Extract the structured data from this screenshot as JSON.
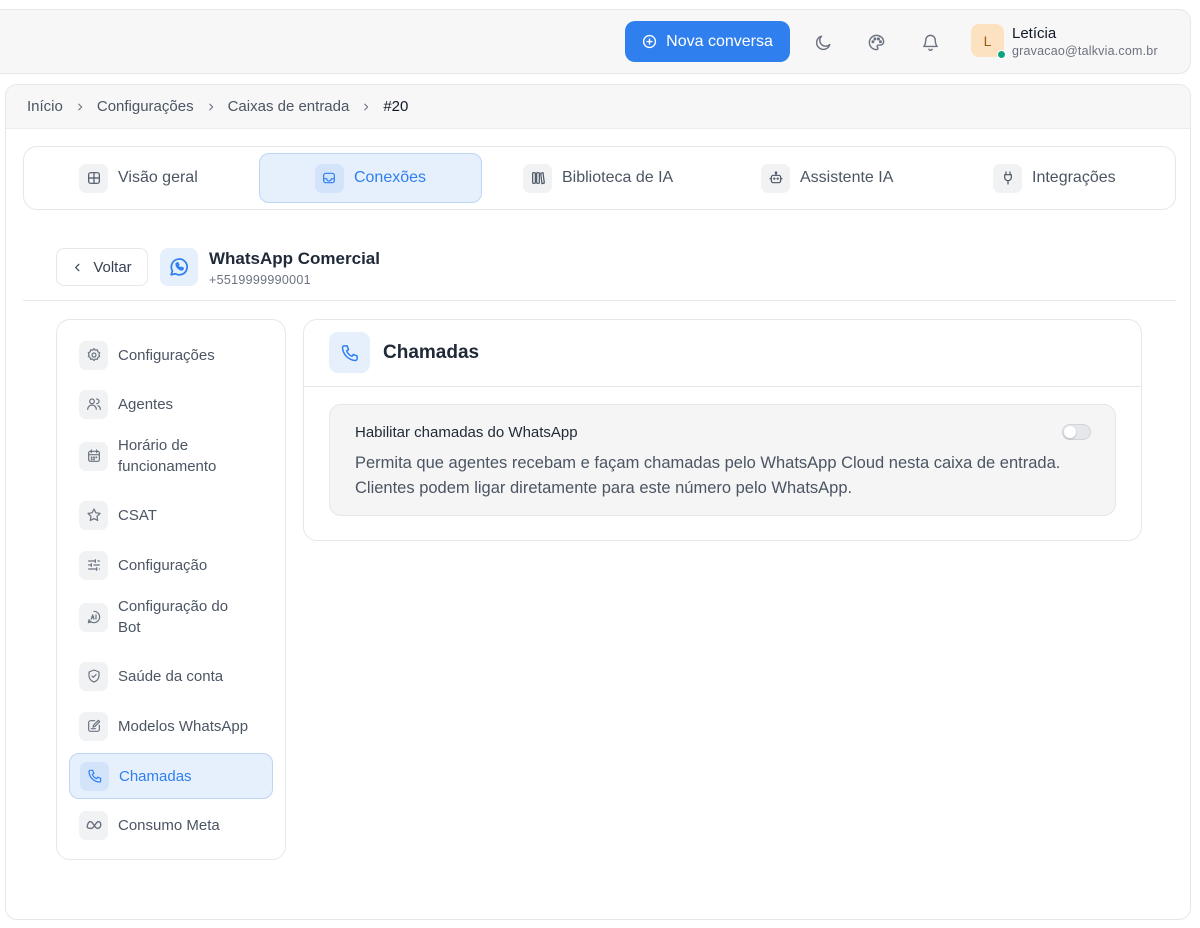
{
  "header": {
    "new_conversation_label": "Nova conversa",
    "user": {
      "initial": "L",
      "name": "Letícia",
      "email": "gravacao@talkvia.com.br"
    }
  },
  "breadcrumb": [
    "Início",
    "Configurações",
    "Caixas de entrada",
    "#20"
  ],
  "tabs": [
    {
      "label": "Visão geral",
      "icon": "grid-icon"
    },
    {
      "label": "Conexões",
      "icon": "inbox-icon",
      "active": true
    },
    {
      "label": "Biblioteca de IA",
      "icon": "library-icon"
    },
    {
      "label": "Assistente IA",
      "icon": "bot-icon"
    },
    {
      "label": "Integrações",
      "icon": "plug-icon"
    }
  ],
  "inbox": {
    "back_label": "Voltar",
    "name": "WhatsApp Comercial",
    "phone": "+5519999990001"
  },
  "menu": [
    {
      "label": "Configurações",
      "icon": "gear-icon"
    },
    {
      "label": "Agentes",
      "icon": "users-icon"
    },
    {
      "label": "Horário de funcionamento",
      "icon": "calendar-icon"
    },
    {
      "label": "CSAT",
      "icon": "star-icon"
    },
    {
      "label": "Configuração",
      "icon": "sliders-icon"
    },
    {
      "label": "Configuração do Bot",
      "icon": "ai-icon"
    },
    {
      "label": "Saúde da conta",
      "icon": "shield-icon"
    },
    {
      "label": "Modelos WhatsApp",
      "icon": "template-icon"
    },
    {
      "label": "Chamadas",
      "icon": "phone-icon",
      "active": true
    },
    {
      "label": "Consumo Meta",
      "icon": "meta-icon"
    }
  ],
  "calls": {
    "title": "Chamadas",
    "setting_title": "Habilitar chamadas do WhatsApp",
    "setting_description": "Permita que agentes recebam e façam chamadas pelo WhatsApp Cloud nesta caixa de entrada. Clientes podem ligar diretamente para este número pelo WhatsApp.",
    "enabled": false
  },
  "colors": {
    "accent": "#2f7fef",
    "online": "#10a37f"
  }
}
